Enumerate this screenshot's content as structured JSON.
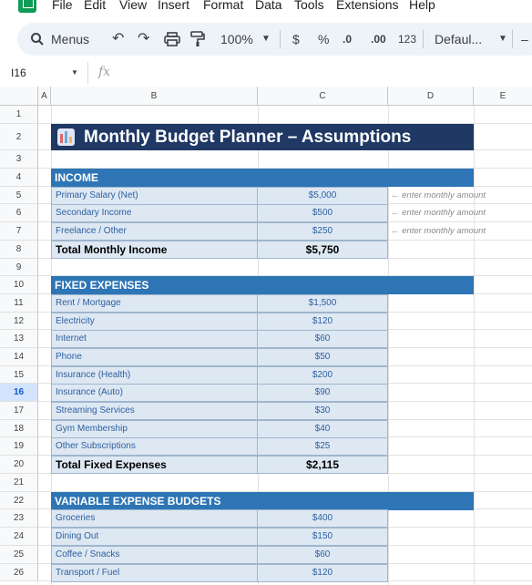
{
  "menu": [
    "File",
    "Edit",
    "View",
    "Insert",
    "Format",
    "Data",
    "Tools",
    "Extensions",
    "Help"
  ],
  "toolbar": {
    "search_label": "Menus",
    "zoom": "100%",
    "currency": "$",
    "percent": "%",
    "decrease_decimal": ".0",
    "increase_decimal": ".00",
    "number_format": "123",
    "font": "Defaul..."
  },
  "formula_bar": {
    "cell_ref": "I16",
    "fx": "fx",
    "value": ""
  },
  "columns": [
    "A",
    "B",
    "C",
    "D",
    "E"
  ],
  "rows": [
    "1",
    "2",
    "3",
    "4",
    "5",
    "6",
    "7",
    "8",
    "9",
    "10",
    "11",
    "12",
    "13",
    "14",
    "15",
    "16",
    "17",
    "18",
    "19",
    "20",
    "21",
    "22",
    "23",
    "24",
    "25",
    "26"
  ],
  "selected_row": "16",
  "sheet": {
    "title": "Monthly Budget Planner – Assumptions",
    "income": {
      "header": "INCOME",
      "items": [
        {
          "label": "Primary Salary (Net)",
          "value": "$5,000",
          "note": "← enter monthly amount"
        },
        {
          "label": "Secondary Income",
          "value": "$500",
          "note": "← enter monthly amount"
        },
        {
          "label": "Freelance / Other",
          "value": "$250",
          "note": "← enter monthly amount"
        }
      ],
      "total_label": "Total Monthly Income",
      "total_value": "$5,750"
    },
    "fixed": {
      "header": "FIXED EXPENSES",
      "items": [
        {
          "label": "Rent / Mortgage",
          "value": "$1,500"
        },
        {
          "label": "Electricity",
          "value": "$120"
        },
        {
          "label": "Internet",
          "value": "$60"
        },
        {
          "label": "Phone",
          "value": "$50"
        },
        {
          "label": "Insurance (Health)",
          "value": "$200"
        },
        {
          "label": "Insurance (Auto)",
          "value": "$90"
        },
        {
          "label": "Streaming Services",
          "value": "$30"
        },
        {
          "label": "Gym Membership",
          "value": "$40"
        },
        {
          "label": "Other Subscriptions",
          "value": "$25"
        }
      ],
      "total_label": "Total Fixed Expenses",
      "total_value": "$2,115"
    },
    "variable": {
      "header": "VARIABLE EXPENSE BUDGETS",
      "items": [
        {
          "label": "Groceries",
          "value": "$400"
        },
        {
          "label": "Dining Out",
          "value": "$150"
        },
        {
          "label": "Coffee / Snacks",
          "value": "$60"
        },
        {
          "label": "Transport / Fuel",
          "value": "$120"
        }
      ]
    }
  },
  "colors": {
    "title_bg": "#1f3864",
    "section_bg": "#2e75b6",
    "cell_bg": "#dde8f3",
    "cell_text": "#2e5f9f"
  }
}
